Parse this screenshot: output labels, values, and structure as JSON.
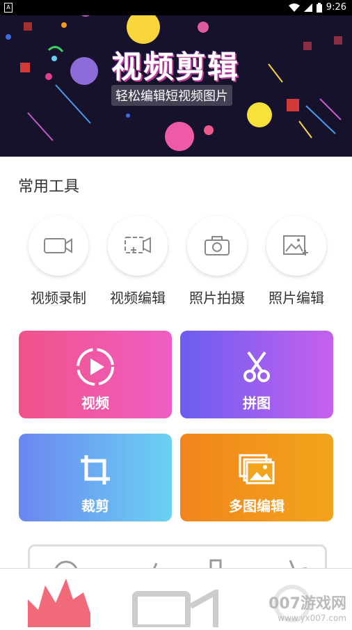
{
  "status_bar": {
    "time": "9:26"
  },
  "banner": {
    "title": "视频剪辑",
    "subtitle": "轻松编辑短视频图片"
  },
  "section": {
    "title": "常用工具"
  },
  "tools": [
    {
      "label": "视频录制",
      "icon": "video-camera-icon"
    },
    {
      "label": "视频编辑",
      "icon": "video-edit-icon"
    },
    {
      "label": "照片拍摄",
      "icon": "photo-camera-icon"
    },
    {
      "label": "照片编辑",
      "icon": "image-edit-icon"
    }
  ],
  "cards": [
    {
      "label": "视频",
      "icon": "play-icon",
      "color_start": "#f05389",
      "color_end": "#ef5ec4"
    },
    {
      "label": "拼图",
      "icon": "scissors-icon",
      "color_start": "#6a5ef0",
      "color_end": "#c660ee"
    },
    {
      "label": "裁剪",
      "icon": "crop-icon",
      "color_start": "#6b86f1",
      "color_end": "#69d2f2"
    },
    {
      "label": "多图编辑",
      "icon": "multi-image-icon",
      "color_start": "#f2851c",
      "color_end": "#f2a41c"
    }
  ],
  "watermark": {
    "main": "007游戏网",
    "url": "www.yx007.com"
  }
}
